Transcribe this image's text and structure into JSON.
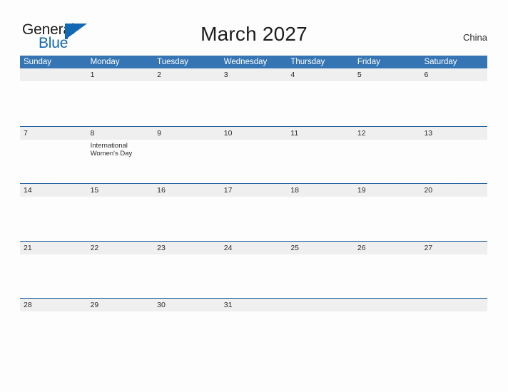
{
  "brand": {
    "name_part1": "General",
    "name_part2": "Blue",
    "logo_icon": "triangle-flag-icon",
    "accent_color": "#1268b3"
  },
  "header": {
    "title": "March 2027",
    "country": "China"
  },
  "theme": {
    "header_blue": "#3575b4",
    "row_rule_blue": "#1f5fa0",
    "band_gray": "#efefef",
    "page_background": "#fdfdfd",
    "text_color": "#2b2b2b"
  },
  "calendar": {
    "month": "March",
    "year": "2027",
    "weekday_headers": [
      "Sunday",
      "Monday",
      "Tuesday",
      "Wednesday",
      "Thursday",
      "Friday",
      "Saturday"
    ],
    "weeks": [
      [
        {
          "day": ""
        },
        {
          "day": "1"
        },
        {
          "day": "2"
        },
        {
          "day": "3"
        },
        {
          "day": "4"
        },
        {
          "day": "5"
        },
        {
          "day": "6"
        }
      ],
      [
        {
          "day": "7"
        },
        {
          "day": "8",
          "event": "International Women's Day"
        },
        {
          "day": "9"
        },
        {
          "day": "10"
        },
        {
          "day": "11"
        },
        {
          "day": "12"
        },
        {
          "day": "13"
        }
      ],
      [
        {
          "day": "14"
        },
        {
          "day": "15"
        },
        {
          "day": "16"
        },
        {
          "day": "17"
        },
        {
          "day": "18"
        },
        {
          "day": "19"
        },
        {
          "day": "20"
        }
      ],
      [
        {
          "day": "21"
        },
        {
          "day": "22"
        },
        {
          "day": "23"
        },
        {
          "day": "24"
        },
        {
          "day": "25"
        },
        {
          "day": "26"
        },
        {
          "day": "27"
        }
      ],
      [
        {
          "day": "28"
        },
        {
          "day": "29"
        },
        {
          "day": "30"
        },
        {
          "day": "31"
        },
        {
          "day": ""
        },
        {
          "day": ""
        },
        {
          "day": ""
        }
      ]
    ]
  }
}
